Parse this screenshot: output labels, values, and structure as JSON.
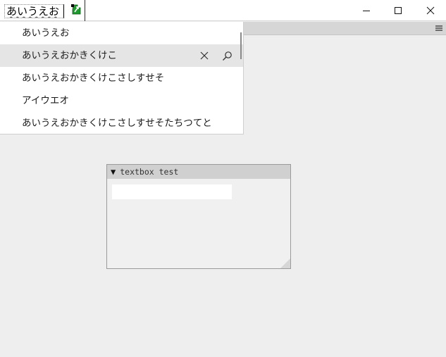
{
  "titlebar": {
    "ime_text": "あいうえお",
    "ime_mode_icon": "ime-mode-icon",
    "minimize_icon": "minimize-icon",
    "maximize_icon": "maximize-icon",
    "close_icon": "close-icon"
  },
  "toolbar": {
    "menu_icon": "hamburger-menu-icon"
  },
  "suggestions": {
    "items": [
      {
        "label": "あいうえお"
      },
      {
        "label": "あいうえおかきくけこ"
      },
      {
        "label": "あいうえおかきくけこさしすせそ"
      },
      {
        "label": "アイウエオ"
      },
      {
        "label": "あいうえおかきくけこさしすせそたちつてと"
      }
    ],
    "selected_index": 1,
    "remove_icon": "remove-icon",
    "search_icon": "search-icon"
  },
  "panel": {
    "toggle": "▼",
    "title": "textbox test",
    "textbox_value": ""
  },
  "colors": {
    "background": "#eeeeee",
    "selected_row": "#e5e5e5",
    "panel_header": "#d0d0d0",
    "ime_icon_green": "#1e9a2f"
  }
}
